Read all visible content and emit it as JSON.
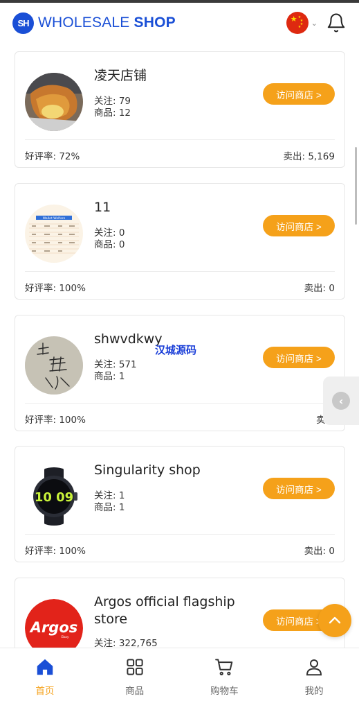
{
  "header": {
    "logo_text": "SH",
    "brand_main": "WHOLESALE ",
    "brand_bold": "SHOP",
    "language": "中文"
  },
  "shops": [
    {
      "name": "凌天店铺",
      "follow": "关注: 79",
      "products": "商品: 12",
      "rating": "好评率: 72%",
      "sold": "卖出: 5,169",
      "visit_label": "访问商店 >"
    },
    {
      "name": "11",
      "follow": "关注: 0",
      "products": "商品: 0",
      "rating": "好评率: 100%",
      "sold": "卖出: 0",
      "visit_label": "访问商店 >"
    },
    {
      "name": "shwvdkwy",
      "follow": "关注: 571",
      "products": "商品: 1",
      "rating": "好评率: 100%",
      "sold": "卖出",
      "visit_label": "访问商店 >"
    },
    {
      "name": "Singularity shop",
      "follow": "关注: 1",
      "products": "商品: 1",
      "rating": "好评率: 100%",
      "sold": "卖出: 0",
      "visit_label": "访问商店 >"
    },
    {
      "name": "Argos official flagship store",
      "follow": "关注: 322,765",
      "visit_label": "访问商店 >"
    }
  ],
  "avatar_texts": {
    "wallet": "Wallet Welfare",
    "argos": "Argos",
    "argos_sub": "Ebay",
    "watch": "10 09"
  },
  "watermark": "汉城源码",
  "nav": [
    {
      "label": "首页",
      "icon": "home-icon",
      "active": true
    },
    {
      "label": "商品",
      "icon": "grid-icon",
      "active": false
    },
    {
      "label": "购物车",
      "icon": "cart-icon",
      "active": false
    },
    {
      "label": "我的",
      "icon": "user-icon",
      "active": false
    }
  ],
  "colors": {
    "brand_blue": "#1a4fd6",
    "accent_orange": "#f5a11a",
    "flag_red": "#de2910"
  }
}
